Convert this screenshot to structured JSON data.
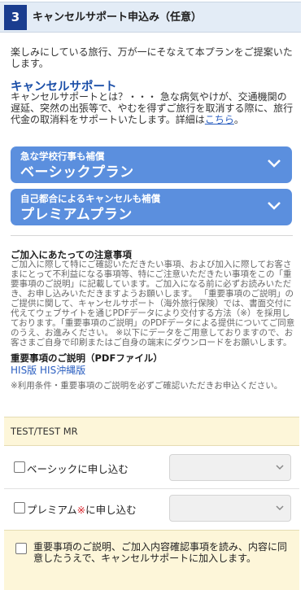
{
  "header": {
    "number": "3",
    "title": "キャンセルサポート申込み（任意）"
  },
  "intro": "楽しみにしている旅行、万が一にそなえて本プランをご提案いたします。",
  "cancel_support": {
    "title": "キャンセルサポート",
    "body": "キャンセルサポートとは？・・・ 急な病気やけが、交通機関の遅延、突然の出張等で、やむを得ずご旅行を取消する際に、旅行代金の取消料をサポートいたします。詳細は",
    "link": "こちら",
    "tail": "。"
  },
  "plans": [
    {
      "subtitle": "急な学校行事も補償",
      "name": "ベーシックプラン"
    },
    {
      "subtitle": "自己都合によるキャンセルも補償",
      "name": "プレミアムプラン"
    }
  ],
  "notes": {
    "title": "ご加入にあたっての注意事項",
    "body": "ご加入に際して特にご確認いただきたい事項、および加入に際してお客さまにとって不利益になる事項等、特にご注意いただきたい事項をこの「重要事項のご説明」に記載しています。ご加入になる前に必ずお読みいただき、お申し込みいただきますようお願いします。 「重要事項のご説明」のご提供に関して、キャンセルサポート（海外旅行保険）では、書面交付に代えてウェブサイトを通じPDFデータにより交付する方法（※）を採用しております。「重要事項のご説明」のPDFデータによる提供についてご同意のうえ、お進みください。 ※以下にデータをご用意しておりますので、お客さまご自身で印刷またはご自身の端末にダウンロードをお願いします。"
  },
  "pdf": {
    "title": "重要事項のご説明（PDFファイル）",
    "link1": "HIS版",
    "link2": "HIS沖縄版",
    "note": "※利用条件・重要事項のご説明を必ずご確認いただきお申込ください。"
  },
  "traveler": {
    "name": "TEST/TEST MR"
  },
  "apply": {
    "basic_label": "ベーシックに申し込む",
    "premium_label": "プレミアム",
    "premium_mark": "※",
    "premium_tail": "に申し込む"
  },
  "confirm_text": "重要事項のご説明、ご加入内容確認事項を読み、内容に同意したうえで、キャンセルサポートに加入します。"
}
